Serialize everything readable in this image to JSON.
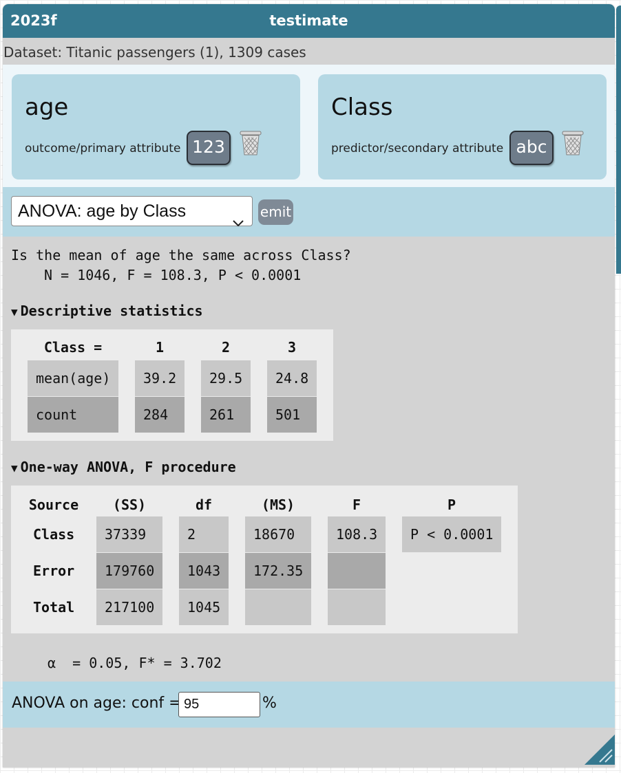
{
  "window": {
    "version": "2023f",
    "title": "testimate"
  },
  "dataset": {
    "label": "Dataset: Titanic passengers (1), 1309 cases"
  },
  "attributes": {
    "primary": {
      "name": "age",
      "role": "outcome/primary attribute",
      "type_label": "123"
    },
    "secondary": {
      "name": "Class",
      "role": "predictor/secondary attribute",
      "type_label": "abc"
    }
  },
  "test": {
    "selected": "ANOVA: age by Class",
    "emit_label": "emit"
  },
  "result": {
    "question": "Is the mean of age the same across Class?",
    "summary": "N = 1046, F = 108.3, P < 0.0001"
  },
  "descriptive": {
    "heading": "Descriptive statistics",
    "group_header": "Class =",
    "groups": [
      "1",
      "2",
      "3"
    ],
    "rows": [
      {
        "label": "mean(age)",
        "values": [
          "39.2",
          "29.5",
          "24.8"
        ]
      },
      {
        "label": "count",
        "values": [
          "284",
          "261",
          "501"
        ]
      }
    ]
  },
  "anova": {
    "heading": "One-way ANOVA, F procedure",
    "headers": [
      "Source",
      "(SS)",
      "df",
      "(MS)",
      "F",
      "P"
    ],
    "rows": [
      {
        "source": "Class",
        "ss": "37339",
        "df": "2",
        "ms": "18670",
        "f": "108.3",
        "p": "P < 0.0001"
      },
      {
        "source": "Error",
        "ss": "179760",
        "df": "1043",
        "ms": "172.35",
        "f": "",
        "p": ""
      },
      {
        "source": "Total",
        "ss": "217100",
        "df": "1045",
        "ms": "",
        "f": "",
        "p": ""
      }
    ]
  },
  "critical": {
    "text": "α  = 0.05, F* = 3.702"
  },
  "config": {
    "label": "ANOVA on age: conf =",
    "value": "95",
    "unit": "%"
  },
  "colors": {
    "titlebar": "#35788f",
    "panel": "#b5d8e4",
    "body": "#d3d3d3",
    "cell_light": "#c8c8c8",
    "cell_dark": "#a9a9a9"
  },
  "icons": [
    "trash-icon",
    "chevron-down-icon",
    "disclosure-triangle-icon",
    "resize-handle-icon"
  ]
}
